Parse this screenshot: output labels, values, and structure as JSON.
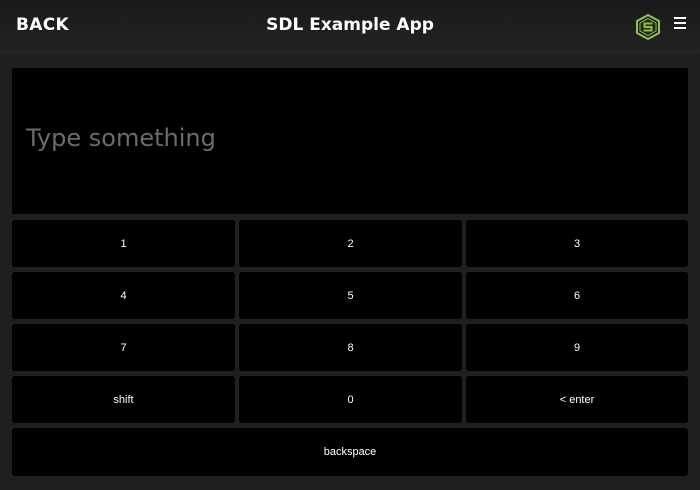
{
  "header": {
    "back_label": "BACK",
    "title": "SDL Example App",
    "logo_icon": "sdl-logo-icon",
    "menu_icon": "hamburger-menu-icon"
  },
  "display": {
    "placeholder": "Type something"
  },
  "keypad": {
    "keys": [
      "1",
      "2",
      "3",
      "4",
      "5",
      "6",
      "7",
      "8",
      "9",
      "shift",
      "0",
      "< enter",
      "backspace"
    ]
  },
  "colors": {
    "background": "#1f1f1f",
    "panel": "#000000",
    "text": "#ffffff",
    "placeholder": "#6b6b6b",
    "logo_accent": "#8fc04a"
  }
}
